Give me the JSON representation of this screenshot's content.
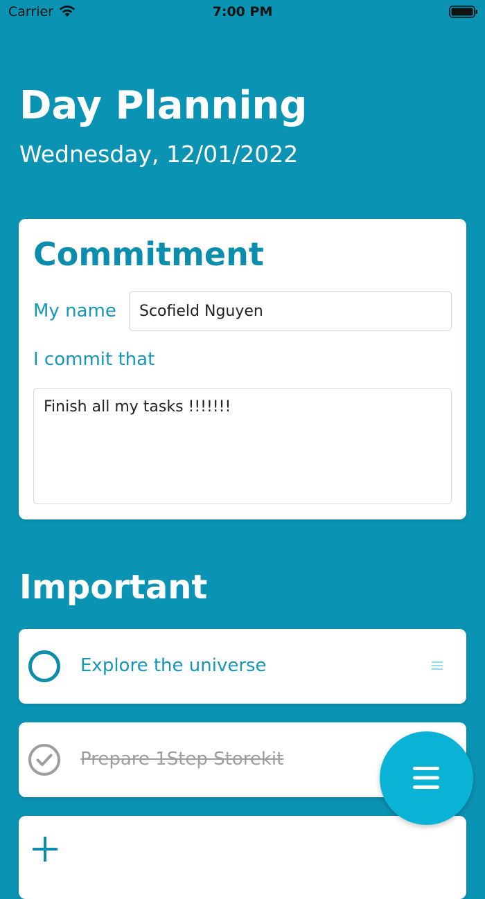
{
  "status_bar": {
    "carrier": "Carrier",
    "time": "7:00 PM",
    "icons": [
      "wifi-icon",
      "battery-icon"
    ]
  },
  "header": {
    "title": "Day Planning",
    "date": "Wednesday, 12/01/2022"
  },
  "commitment": {
    "title": "Commitment",
    "name_label": "My name",
    "name_value": "Scofield Nguyen",
    "commit_label": "I commit that",
    "commit_value": "Finish all my tasks !!!!!!!"
  },
  "important": {
    "title": "Important",
    "tasks": [
      {
        "label": "Explore the universe",
        "done": false
      },
      {
        "label": "Prepare 1Step Storekit",
        "done": true
      }
    ],
    "add_icon": "plus-icon"
  },
  "fab": {
    "icon": "menu-icon"
  },
  "colors": {
    "background": "#0b93b4",
    "accent": "#0b8eae",
    "label": "#1797b8",
    "fab": "#0ab3d6",
    "done": "#9e9e9e"
  }
}
